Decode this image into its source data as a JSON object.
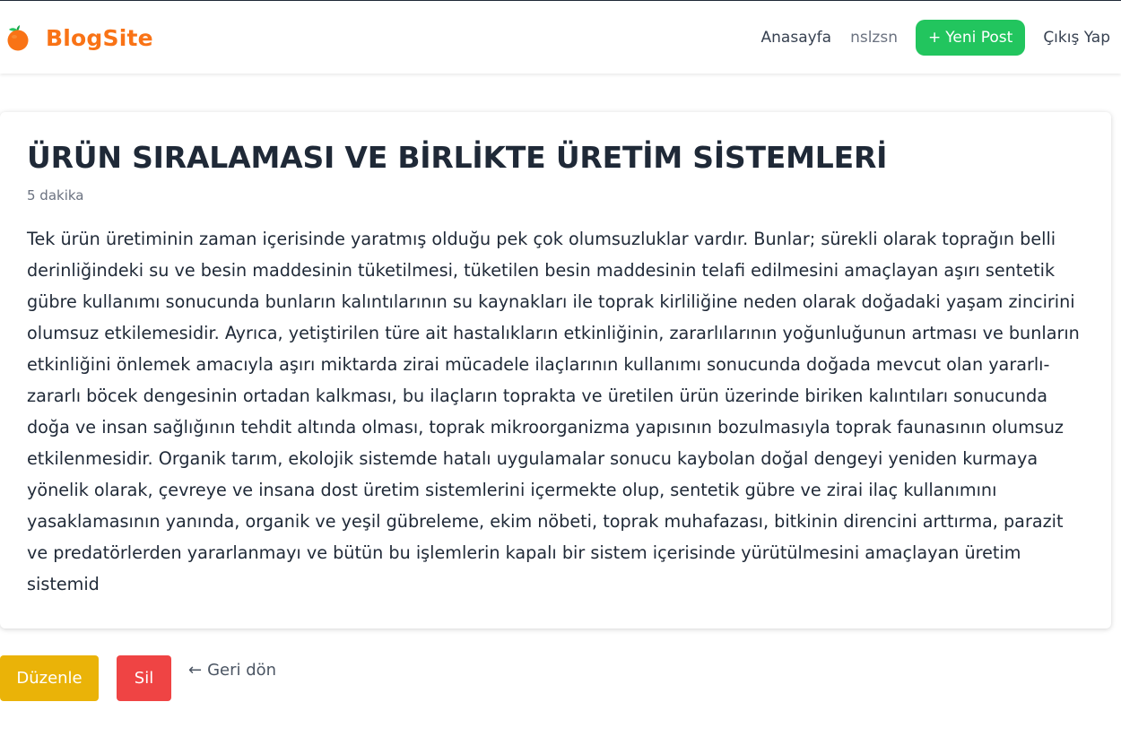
{
  "header": {
    "brand_name": "BlogSite",
    "brand_icon": "orange-fruit-icon",
    "nav": {
      "home_label": "Anasayfa",
      "username": "nslzsn",
      "new_post_icon": "+",
      "new_post_label": "Yeni Post",
      "logout_label": "Çıkış Yap"
    }
  },
  "post": {
    "title": "ÜRÜN SIRALAMASI VE BİRLİKTE ÜRETİM SİSTEMLERİ",
    "read_time": "5 dakika",
    "body": "Tek ürün üretiminin zaman içerisinde yaratmış olduğu pek çok olumsuzluklar vardır. Bunlar; sürekli olarak toprağın belli derinliğindeki su ve besin maddesinin tüketilmesi, tüketilen besin maddesinin telafi edilmesini amaçlayan aşırı sentetik gübre kullanımı sonucunda bunların kalıntılarının su kaynakları ile toprak kirliliğine neden olarak doğadaki yaşam zincirini olumsuz etkilemesidir. Ayrıca, yetiştirilen türe ait hastalıkların etkinliğinin, zararlılarının yoğunluğunun artması ve bunların etkinliğini önlemek amacıyla aşırı miktarda zirai mücadele ilaçlarının kullanımı sonucunda doğada mevcut olan yararlı-zararlı böcek dengesinin ortadan kalkması, bu ilaçların toprakta ve üretilen ürün üzerinde biriken kalıntıları sonucunda doğa ve insan sağlığının tehdit altında olması, toprak mikroorganizma yapısının bozulmasıyla toprak faunasının olumsuz etkilenmesidir. Organik tarım, ekolojik sistemde hatalı uygulamalar sonucu kaybolan doğal dengeyi yeniden kurmaya yönelik olarak, çevreye ve insana dost üretim sistemlerini içermekte olup, sentetik gübre ve zirai ilaç kullanımını yasaklamasının yanında, organik ve yeşil gübreleme, ekim nöbeti, toprak muhafazası, bitkinin direncini arttırma, parazit ve predatörlerden yararlanmayı ve bütün bu işlemlerin kapalı bir sistem içerisinde yürütülmesini amaçlayan üretim sistemid"
  },
  "actions": {
    "edit_label": "Düzenle",
    "delete_label": "Sil",
    "back_arrow": "←",
    "back_label": "Geri dön"
  },
  "colors": {
    "brand": "#f97316",
    "new_post_button": "#22c55e",
    "edit_button": "#eab308",
    "delete_button": "#ef4444"
  }
}
